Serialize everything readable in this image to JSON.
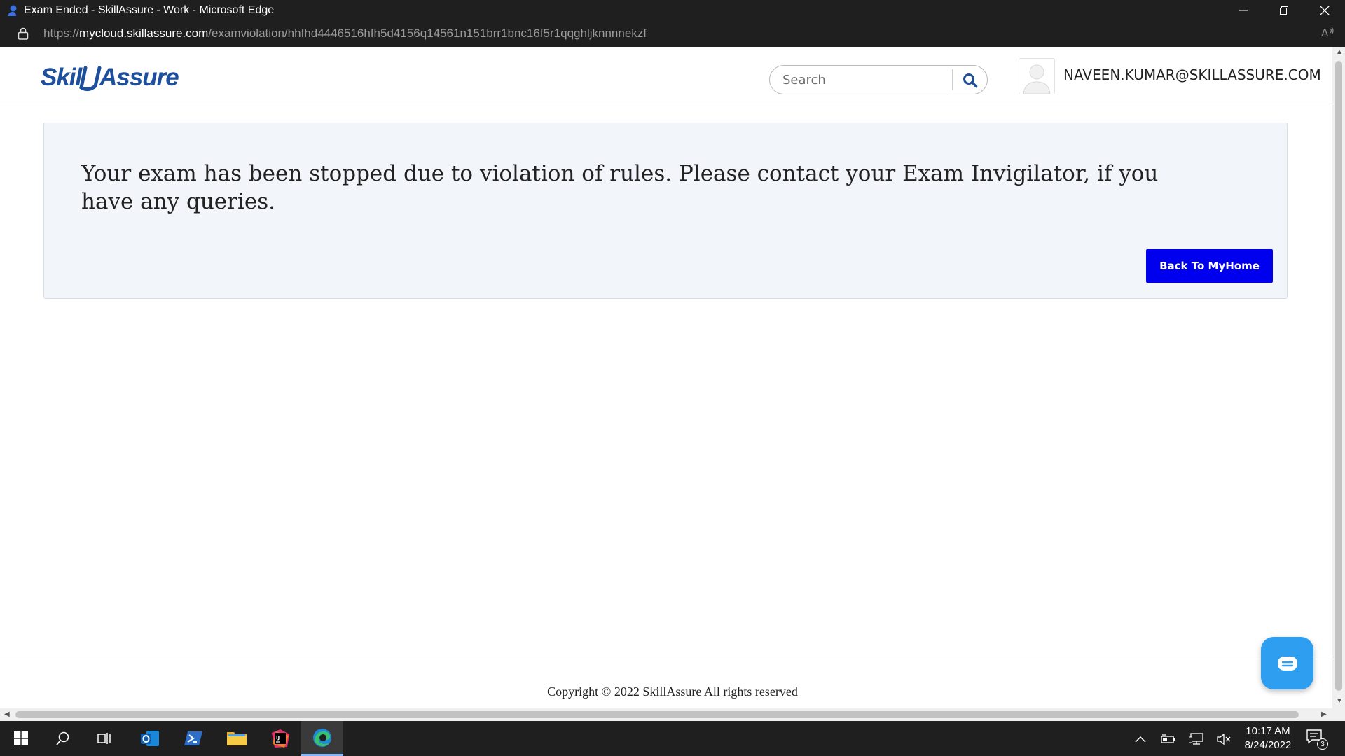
{
  "window": {
    "title": "Exam Ended - SkillAssure - Work - Microsoft Edge"
  },
  "address_bar": {
    "scheme": "https://",
    "host": "mycloud.skillassure.com",
    "path": "/examviolation/hhfhd4446516hfh5d4156q14561n151brr1bnc16f5r1qqghljknnnnekzf"
  },
  "header": {
    "logo_text": "SkillAssure",
    "search_placeholder": "Search",
    "user_email": "NAVEEN.KUMAR@SKILLASSURE.COM"
  },
  "main": {
    "message": "Your exam has been stopped due to violation of rules. Please contact your Exam Invigilator, if you have any queries.",
    "back_button_label": "Back To MyHome"
  },
  "footer": {
    "copyright": "Copyright © 2022 SkillAssure All rights reserved"
  },
  "colors": {
    "brand_blue": "#1d4f9c",
    "button_blue": "#0000ee",
    "chat_blue": "#2d9ef0",
    "card_bg": "#f2f6fa"
  },
  "taskbar": {
    "apps": [
      "windows-start-icon",
      "search-icon",
      "task-view-icon",
      "outlook-icon",
      "powershell-icon",
      "file-explorer-icon",
      "intellij-icon",
      "edge-icon"
    ],
    "active_app": "edge-icon",
    "time": "10:17 AM",
    "date": "8/24/2022",
    "notification_count": "3"
  }
}
